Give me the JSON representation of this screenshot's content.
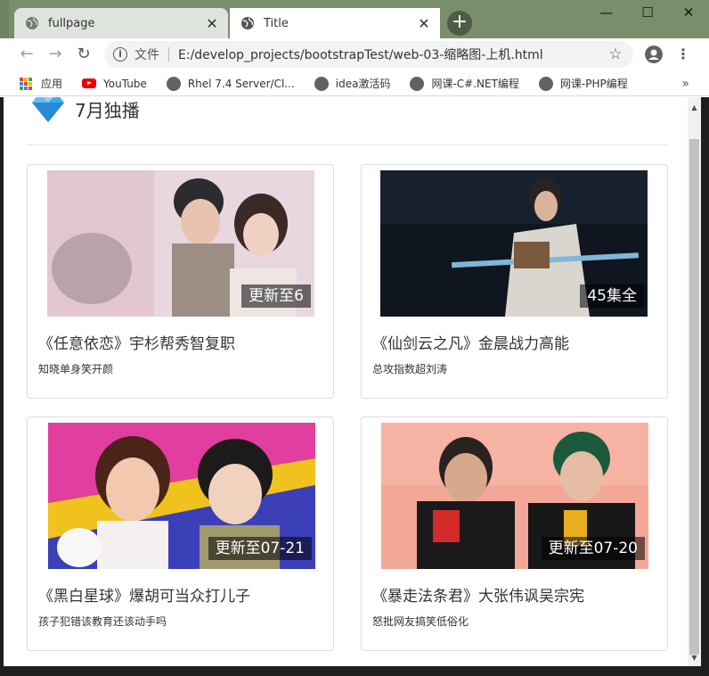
{
  "browser": {
    "tabs": [
      {
        "label": "fullpage",
        "active": true
      },
      {
        "label": "Title",
        "active": false
      }
    ],
    "newtab_label": "+",
    "window_controls": {
      "minimize": "—",
      "maximize": "☐",
      "close": "✕"
    },
    "address": {
      "scheme_label": "文件",
      "url": "E:/develop_projects/bootstrapTest/web-03-缩略图-上机.html"
    },
    "bookmarks": [
      {
        "label": "应用",
        "icon": "apps-grid-icon"
      },
      {
        "label": "YouTube",
        "icon": "youtube-icon"
      },
      {
        "label": "Rhel 7.4 Server/Cl...",
        "icon": "globe-icon"
      },
      {
        "label": "idea激活码",
        "icon": "globe-icon"
      },
      {
        "label": "网课-C#.NET编程",
        "icon": "globe-icon"
      },
      {
        "label": "网课-PHP编程",
        "icon": "globe-icon"
      }
    ],
    "bookmarks_more": "»"
  },
  "page": {
    "heading": "7月独播",
    "cards": [
      {
        "badge": "更新至6",
        "title": "《任意依恋》宇杉帮秀智复职",
        "subtitle": "知晓单身笑开颜"
      },
      {
        "badge": "45集全",
        "title": "《仙剑云之凡》金晨战力高能",
        "subtitle": "总攻指数超刘涛"
      },
      {
        "badge": "更新至07-21",
        "title": "《黑白星球》爆胡可当众打儿子",
        "subtitle": "孩子犯错该教育还该动手吗"
      },
      {
        "badge": "更新至07-20",
        "title": "《暴走法条君》大张伟讽吴宗宪",
        "subtitle": "怒批网友搞笑低俗化"
      }
    ]
  },
  "colors": {
    "titlebar": "#7a8e6c",
    "tab_active": "#dfe3de",
    "card_border": "#dddddd",
    "badge_bg": "rgba(0,0,0,0.55)"
  }
}
